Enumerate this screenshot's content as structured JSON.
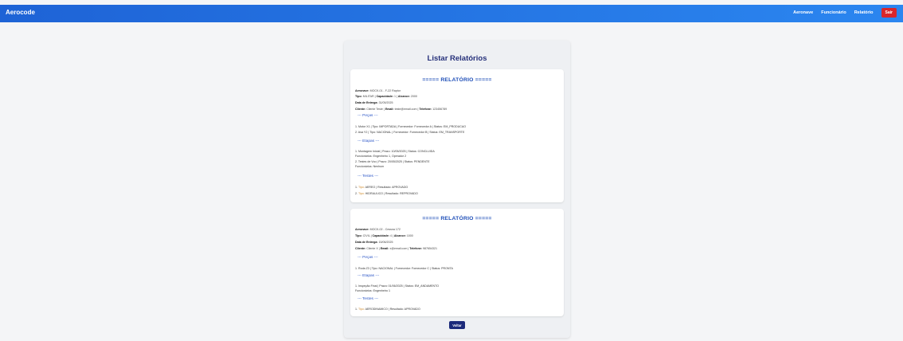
{
  "header": {
    "brand": "Aerocode",
    "nav": [
      "Aeronave",
      "Funcionário",
      "Relatório"
    ],
    "exit_label": "Sair"
  },
  "page": {
    "title": "Listar Relatórios",
    "back_label": "Voltar"
  },
  "reports": [
    {
      "title": "===== RELATÓRIO =====",
      "aeronave_label": "Aeronave:",
      "aeronave_value": "MOCK-01 - F-22 Raptor",
      "tipo_label": "Tipo:",
      "tipo_value": "MILITAR",
      "capacidade_label": "Capacidade:",
      "capacidade_value": "1",
      "alcance_label": "Alcance:",
      "alcance_value": "2000",
      "entrega_label": "Data de Entrega:",
      "entrega_value": "31/05/2025",
      "cliente_label": "Cliente:",
      "cliente_value": "Cliente Teste",
      "email_label": "Email:",
      "email_value": "teste@email.com",
      "telefone_label": "Telefone:",
      "telefone_value": "123456789",
      "pecas_header": "--- Peças ---",
      "pecas": [
        "1. Motor X1 | Tipo: IMPORTADA | Fornecedor: Fornecedor A | Status: EM_PRODUCAO",
        "2. Asa Y2 | Tipo: NACIONAL | Fornecedor: Fornecedor B | Status: EM_TRANSPORTE"
      ],
      "etapas_header": "--- Etapas ---",
      "etapas": [
        {
          "text": "1. Montagem Inicial | Prazo: 10/05/2025 | Status: CONCLUIDA",
          "func": "Funcionários: Engenheiro 1, Operador 2"
        },
        {
          "text": "2. Testes de Voo | Prazo: 20/05/2025 | Status: PENDENTE",
          "func": "Funcionários: Nenhum"
        }
      ],
      "testes_header": "--- Testes ---",
      "testes": [
        {
          "tipo": "AEREO",
          "rest": " | Resultado: APROVADO"
        },
        {
          "tipo": "HIDRAULICO",
          "rest": " | Resultado: REPROVADO"
        }
      ]
    },
    {
      "title": "===== RELATÓRIO =====",
      "aeronave_label": "Aeronave:",
      "aeronave_value": "MOCK-02 - Cessna 172",
      "tipo_label": "Tipo:",
      "tipo_value": "CIVIL",
      "capacidade_label": "Capacidade:",
      "capacidade_value": "4",
      "alcance_label": "Alcance:",
      "alcance_value": "1000",
      "entrega_label": "Data de Entrega:",
      "entrega_value": "15/06/2025",
      "cliente_label": "Cliente:",
      "cliente_value": "Cliente X",
      "email_label": "Email:",
      "email_value": "x@email.com",
      "telefone_label": "Telefone:",
      "telefone_value": "987654321",
      "pecas_header": "--- Peças ---",
      "pecas": [
        "1. Roda Z3 | Tipo: NACIONAL | Fornecedor: Fornecedor C | Status: PRONTA"
      ],
      "etapas_header": "--- Etapas ---",
      "etapas": [
        {
          "text": "1. Inspeção Final | Prazo: 01/06/2025 | Status: EM_ANDAMENTO",
          "func": "Funcionários: Engenheiro 1"
        }
      ],
      "testes_header": "--- Testes ---",
      "testes": [
        {
          "tipo": "AERODINAMICO",
          "rest": " | Resultado: APROVADO"
        }
      ]
    }
  ]
}
